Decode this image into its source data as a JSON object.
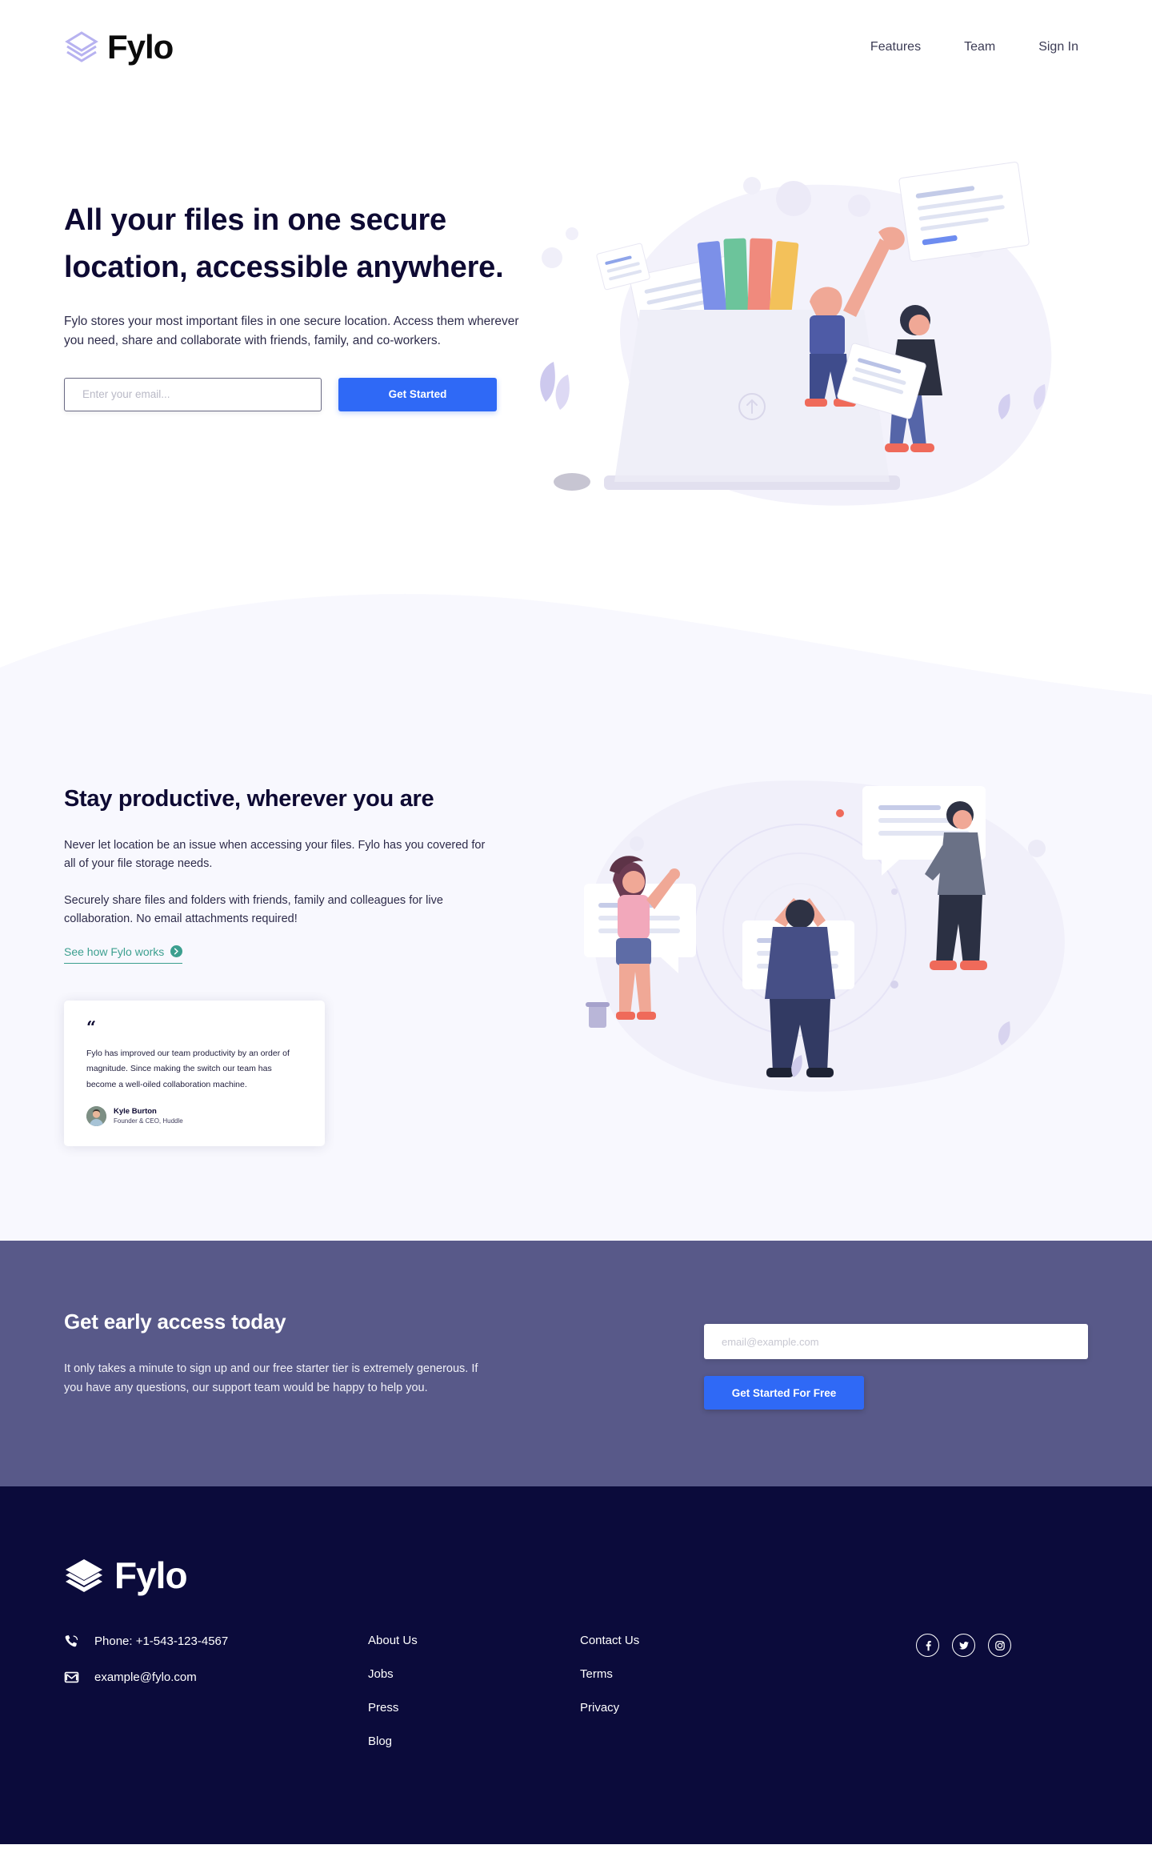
{
  "header": {
    "logo_text": "Fylo",
    "logo_icon": "stacked-layers-icon",
    "nav": [
      {
        "label": "Features"
      },
      {
        "label": "Team"
      },
      {
        "label": "Sign In"
      }
    ]
  },
  "hero": {
    "title_line1": "All your files in one secure",
    "title_line2": "location, accessible anywhere.",
    "body": "Fylo stores your most important files in one secure location. Access them wherever you need, share and collaborate with friends, family, and co-workers.",
    "email_placeholder": "Enter your email...",
    "email_value": "",
    "cta_label": "Get Started",
    "illustration": "person-uploading-files-to-folder-illustration"
  },
  "productive": {
    "title": "Stay productive, wherever you are",
    "paragraph1": "Never let location be an issue when accessing your files. Fylo has you covered for all of your file storage needs.",
    "paragraph2": "Securely share files and folders with friends, family and colleagues for live collaboration. No email attachments required!",
    "link_label": "See how Fylo works",
    "link_icon": "arrow-right-circle-icon",
    "link_color": "#3c9f8f",
    "illustration": "team-collaboration-illustration",
    "testimonial": {
      "quote_mark": "“",
      "text": "Fylo has improved our team productivity by an order of magnitude. Since making the switch our team has become a well-oiled collaboration machine.",
      "author_name": "Kyle Burton",
      "author_role": "Founder & CEO, Huddle",
      "avatar": "kyle-burton-avatar"
    }
  },
  "cta": {
    "title": "Get early access today",
    "body": "It only takes a minute to sign up and our free starter tier is extremely generous. If you have any questions, our support team would be happy to help you.",
    "email_placeholder": "email@example.com",
    "email_value": "",
    "button_label": "Get Started For Free",
    "background_color": "#585989"
  },
  "footer": {
    "logo_text": "Fylo",
    "logo_icon": "stacked-layers-icon",
    "background_color": "#0b0b3b",
    "contact": [
      {
        "icon": "phone-icon",
        "text": "Phone: +1-543-123-4567"
      },
      {
        "icon": "email-icon",
        "text": "example@fylo.com"
      }
    ],
    "links_col1": [
      {
        "label": "About Us"
      },
      {
        "label": "Jobs"
      },
      {
        "label": "Press"
      },
      {
        "label": "Blog"
      }
    ],
    "links_col2": [
      {
        "label": "Contact Us"
      },
      {
        "label": "Terms"
      },
      {
        "label": "Privacy"
      }
    ],
    "social": [
      {
        "icon": "facebook-icon",
        "label": "Facebook"
      },
      {
        "icon": "twitter-icon",
        "label": "Twitter"
      },
      {
        "icon": "instagram-icon",
        "label": "Instagram"
      }
    ]
  },
  "theme": {
    "accent_blue": "#2f69f6",
    "dark_navy": "#070439",
    "light_bg": "#f8f8fe",
    "logo_purple": "#b7b2f0"
  }
}
